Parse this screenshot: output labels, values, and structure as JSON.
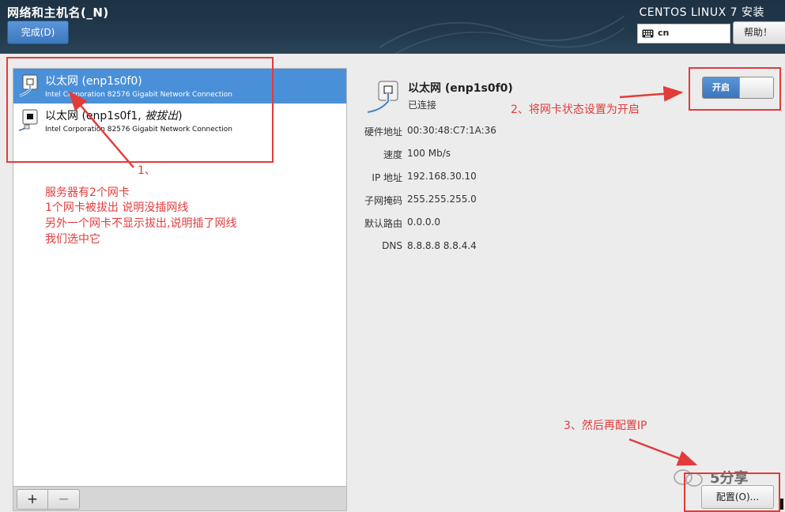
{
  "header": {
    "title": "网络和主机名(_N)",
    "done_button": "完成(D)",
    "product": "CENTOS LINUX 7 安装",
    "keyboard_layout": "cn",
    "help_button": "帮助！"
  },
  "devices": [
    {
      "name": "以太网 (enp1s0f0)",
      "name_suffix": "",
      "description": "Intel Corporation 82576 Gigabit Network Connection",
      "selected": true
    },
    {
      "name": "以太网 (enp1s0f1, ",
      "name_suffix": "被拔出",
      "name_close": ")",
      "description": "Intel Corporation 82576 Gigabit Network Connection",
      "selected": false
    }
  ],
  "list_controls": {
    "add": "+",
    "remove": "−"
  },
  "details": {
    "name": "以太网 (enp1s0f0)",
    "status": "已连接",
    "toggle_on_label": "开启",
    "properties": [
      {
        "label": "硬件地址",
        "value": "00:30:48:C7:1A:36"
      },
      {
        "label": "速度",
        "value": "100 Mb/s"
      },
      {
        "label": "IP 地址",
        "value": "192.168.30.10"
      },
      {
        "label": "子网掩码",
        "value": "255.255.255.0"
      },
      {
        "label": "默认路由",
        "value": "0.0.0.0"
      },
      {
        "label": "DNS",
        "value": "8.8.8.8 8.8.4.4"
      }
    ],
    "configure_button": "配置(O)..."
  },
  "watermark": "5分享",
  "annotations": {
    "step1_label": "1、",
    "step1_lines": [
      "服务器有2个网卡",
      "1个网卡被拔出 说明没插网线",
      "另外一个网卡不显示拔出,说明插了网线",
      "我们选中它"
    ],
    "step2_label": "2、将网卡状态设置为开启",
    "step3_label": "3、然后再配置IP"
  },
  "colors": {
    "header_bg": "#22384b",
    "selection": "#4a90d9",
    "accent_button": "#4a86c8",
    "annotation_red": "#e23b3b"
  }
}
